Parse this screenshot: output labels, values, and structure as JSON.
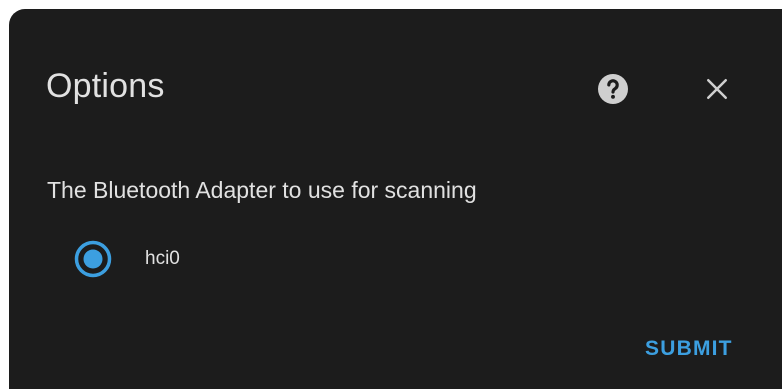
{
  "dialog": {
    "title": "Options",
    "help_icon": "help-circle-icon",
    "close_icon": "close-icon"
  },
  "form": {
    "field_label": "The Bluetooth Adapter to use for scanning",
    "options": [
      {
        "label": "hci0",
        "selected": true
      }
    ]
  },
  "actions": {
    "submit_label": "SUBMIT"
  },
  "colors": {
    "background": "#1c1c1c",
    "text": "#e1e1e1",
    "accent": "#3c9fe0"
  }
}
